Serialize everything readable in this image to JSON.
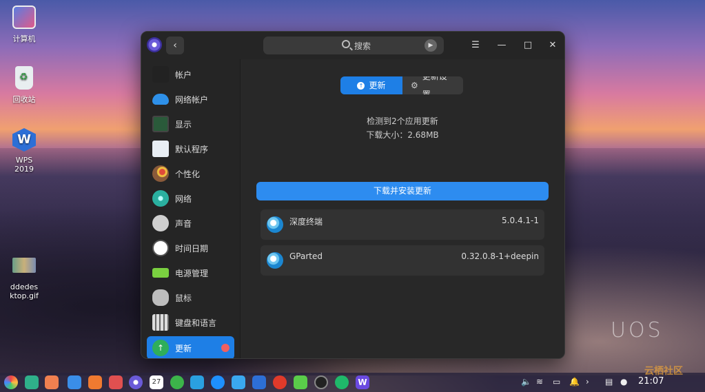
{
  "desktop": {
    "icons": [
      {
        "label": "计算机",
        "icon": "computer-icon"
      },
      {
        "label": "回收站",
        "icon": "trash-icon"
      },
      {
        "label_line1": "WPS",
        "label_line2": "2019",
        "icon": "wps-icon"
      },
      {
        "label_line1": "ddedes",
        "label_line2": "ktop.gif",
        "icon": "gif-file-icon"
      }
    ],
    "wallpaper_mark": "UOS"
  },
  "window": {
    "search_placeholder": "搜索",
    "back_symbol": "‹",
    "controls": {
      "menu": "☰",
      "minimize": "—",
      "maximize": "□",
      "close": "✕"
    },
    "sidebar": {
      "items": [
        {
          "label": "帐户",
          "icon": "account-icon"
        },
        {
          "label": "网络帐户",
          "icon": "cloud-icon"
        },
        {
          "label": "显示",
          "icon": "display-icon"
        },
        {
          "label": "默认程序",
          "icon": "default-apps-icon"
        },
        {
          "label": "个性化",
          "icon": "personalization-icon"
        },
        {
          "label": "网络",
          "icon": "network-icon"
        },
        {
          "label": "声音",
          "icon": "sound-icon"
        },
        {
          "label": "时间日期",
          "icon": "clock-icon"
        },
        {
          "label": "电源管理",
          "icon": "battery-icon"
        },
        {
          "label": "鼠标",
          "icon": "mouse-icon"
        },
        {
          "label": "键盘和语言",
          "icon": "keyboard-icon"
        },
        {
          "label": "更新",
          "icon": "update-icon",
          "active": true,
          "badge": true
        }
      ]
    },
    "main": {
      "tabs": [
        {
          "label": "更新",
          "active": true
        },
        {
          "label": "更新设置",
          "active": false
        }
      ],
      "summary_line1": "检测到2个应用更新",
      "summary_line2": "下载大小：2.68MB",
      "install_button": "下载并安装更新",
      "updates": [
        {
          "name": "深度终端",
          "version": "5.0.4.1-1"
        },
        {
          "name": "GParted",
          "version": "0.32.0.8-1+deepin"
        }
      ]
    }
  },
  "taskbar": {
    "clock": "21:07",
    "calendar_day": "27"
  },
  "watermark": "云栖社区"
}
